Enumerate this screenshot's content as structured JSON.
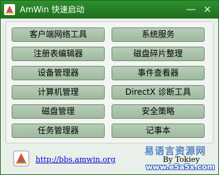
{
  "window": {
    "title": "AmWin 快速启动",
    "minimize_glyph": "—",
    "close_glyph": "×"
  },
  "tools": [
    {
      "label": "客户端网络工具"
    },
    {
      "label": "系统服务"
    },
    {
      "label": "注册表编辑器"
    },
    {
      "label": "磁盘碎片整理"
    },
    {
      "label": "设备管理器"
    },
    {
      "label": "事件查看器"
    },
    {
      "label": "计算机管理"
    },
    {
      "label": "DirectX 诊断工具"
    },
    {
      "label": "磁盘管理"
    },
    {
      "label": "安全策略"
    },
    {
      "label": "任务管理器"
    },
    {
      "label": "记事本"
    }
  ],
  "footer": {
    "link": "http://bbs.amwin.org",
    "by": "By Tokiey"
  },
  "watermark": {
    "cn": "易语言资源网",
    "url": "www.e5a5x.com"
  },
  "colors": {
    "titlebar": "#2a8a2a",
    "button": "#a9c3a9",
    "link": "#0000cc"
  },
  "icons": {
    "app": "amwin-logo-icon",
    "minimize": "minimize-icon",
    "close": "close-icon"
  }
}
